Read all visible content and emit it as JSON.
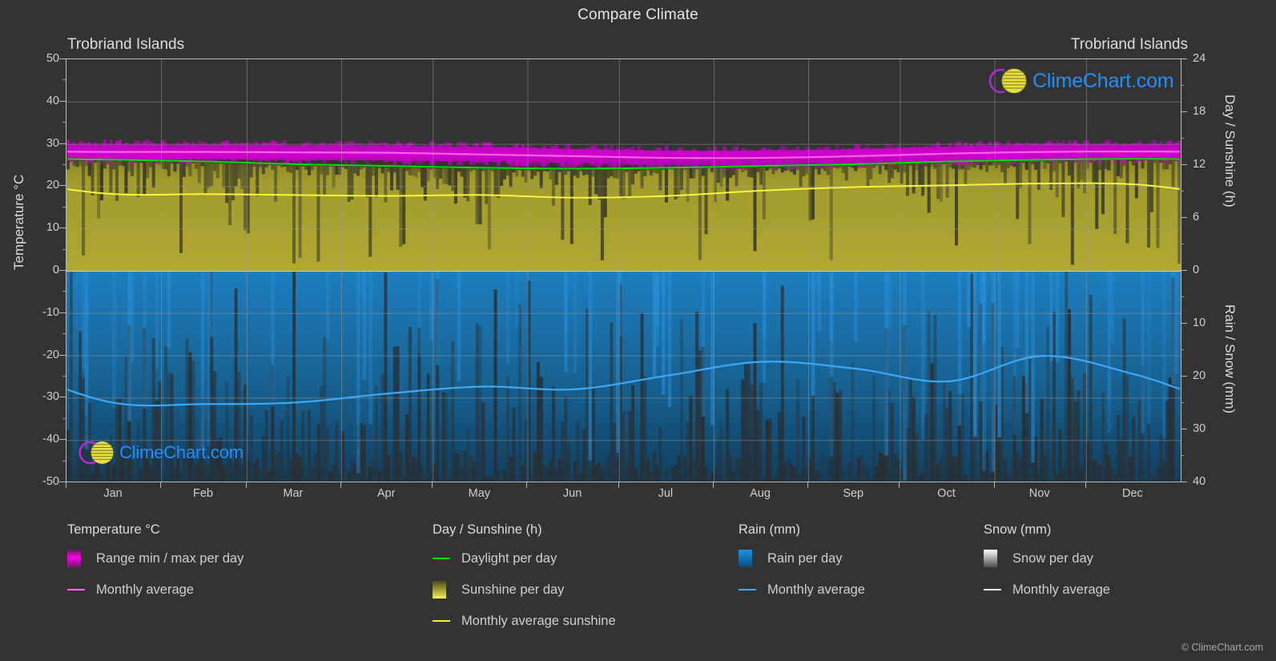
{
  "header": {
    "title": "Compare Climate",
    "location_left": "Trobriand Islands",
    "location_right": "Trobriand Islands"
  },
  "axes": {
    "left_title": "Temperature °C",
    "right_top_title": "Day / Sunshine (h)",
    "right_bottom_title": "Rain / Snow (mm)",
    "left_ticks": [
      "50",
      "40",
      "30",
      "20",
      "10",
      "0",
      "-10",
      "-20",
      "-30",
      "-40",
      "-50"
    ],
    "right_ticks": [
      "24",
      "18",
      "12",
      "6",
      "0",
      "10",
      "20",
      "30",
      "40"
    ],
    "x_ticks": [
      "Jan",
      "Feb",
      "Mar",
      "Apr",
      "May",
      "Jun",
      "Jul",
      "Aug",
      "Sep",
      "Oct",
      "Nov",
      "Dec"
    ]
  },
  "legend": {
    "groups": [
      {
        "title": "Temperature °C",
        "items": [
          {
            "label": "Range min / max per day",
            "key": "swatch",
            "color": "#ff00e0"
          },
          {
            "label": "Monthly average",
            "key": "line",
            "color": "#ff63e4"
          }
        ]
      },
      {
        "title": "Day / Sunshine (h)",
        "items": [
          {
            "label": "Daylight per day",
            "key": "line",
            "color": "#00e000"
          },
          {
            "label": "Sunshine per day",
            "key": "swatch",
            "color": "#f2f24a"
          },
          {
            "label": "Monthly average sunshine",
            "key": "line",
            "color": "#f5f53c"
          }
        ]
      },
      {
        "title": "Rain (mm)",
        "items": [
          {
            "label": "Rain per day",
            "key": "swatch",
            "color": "#1589d6"
          },
          {
            "label": "Monthly average",
            "key": "line",
            "color": "#3fa9f5"
          }
        ]
      },
      {
        "title": "Snow (mm)",
        "items": [
          {
            "label": "Snow per day",
            "key": "swatch",
            "color": "#f2f2f2"
          },
          {
            "label": "Monthly average",
            "key": "line",
            "color": "#e8e8e8"
          }
        ]
      }
    ]
  },
  "watermark": {
    "text": "ClimeChart.com",
    "ring_color": "#c428d4",
    "sphere_color": "#e8e03c",
    "text_color": "#1e90ff"
  },
  "footer": {
    "copyright": "© ClimeChart.com"
  },
  "colors": {
    "background": "#333333",
    "grid": "#9b9b9b",
    "temp_range": "#d200d2",
    "temp_avg": "#ff63e4",
    "daylight": "#00e000",
    "sunshine_fill": "#a8a02a",
    "sunshine_avg": "#f5f53c",
    "rain_fill": "#1b6fa8",
    "rain_avg": "#3fa9f5"
  },
  "chart_data": {
    "type": "area",
    "title": "Compare Climate",
    "subtitle": "Trobriand Islands",
    "xlabel": "",
    "ylabel": "Temperature °C",
    "ylabel_right_top": "Day / Sunshine (h)",
    "ylabel_right_bottom": "Rain / Snow (mm)",
    "ylim": [
      -50,
      50
    ],
    "ylim_right_top": [
      0,
      24
    ],
    "ylim_right_bottom": [
      0,
      40
    ],
    "grid": true,
    "legend_position": "below",
    "categories": [
      "Jan",
      "Feb",
      "Mar",
      "Apr",
      "May",
      "Jun",
      "Jul",
      "Aug",
      "Sep",
      "Oct",
      "Nov",
      "Dec"
    ],
    "series": [
      {
        "name": "Temperature max per day (°C)",
        "axis": "left",
        "unit": "°C",
        "values": [
          29.8,
          29.8,
          29.7,
          29.6,
          29.3,
          28.8,
          28.4,
          28.4,
          28.8,
          29.4,
          29.8,
          29.9
        ]
      },
      {
        "name": "Temperature min per day (°C)",
        "axis": "left",
        "unit": "°C",
        "values": [
          26.3,
          26.3,
          26.2,
          26.1,
          25.8,
          25.4,
          25.0,
          25.0,
          25.3,
          25.9,
          26.3,
          26.4
        ]
      },
      {
        "name": "Monthly average temperature (°C)",
        "axis": "left",
        "unit": "°C",
        "values": [
          28.1,
          28.1,
          28.0,
          27.9,
          27.5,
          27.1,
          26.7,
          26.7,
          27.1,
          27.7,
          28.1,
          28.2
        ]
      },
      {
        "name": "Daylight per day (h)",
        "axis": "right_top",
        "unit": "h",
        "values": [
          12.6,
          12.4,
          12.1,
          11.9,
          11.7,
          11.6,
          11.7,
          11.9,
          12.1,
          12.4,
          12.6,
          12.7
        ]
      },
      {
        "name": "Monthly average sunshine (h)",
        "axis": "right_top",
        "unit": "h",
        "values": [
          8.7,
          8.7,
          8.6,
          8.5,
          8.6,
          8.3,
          8.5,
          9.1,
          9.5,
          9.7,
          9.9,
          9.8
        ]
      },
      {
        "name": "Monthly average rain (mm)",
        "axis": "right_bottom",
        "unit": "mm",
        "values": [
          25.0,
          25.2,
          24.9,
          23.2,
          21.9,
          22.4,
          19.8,
          17.2,
          18.5,
          20.9,
          16.1,
          19.6
        ]
      },
      {
        "name": "Monthly average snow (mm)",
        "axis": "right_bottom",
        "unit": "mm",
        "values": [
          0,
          0,
          0,
          0,
          0,
          0,
          0,
          0,
          0,
          0,
          0,
          0
        ]
      }
    ]
  }
}
